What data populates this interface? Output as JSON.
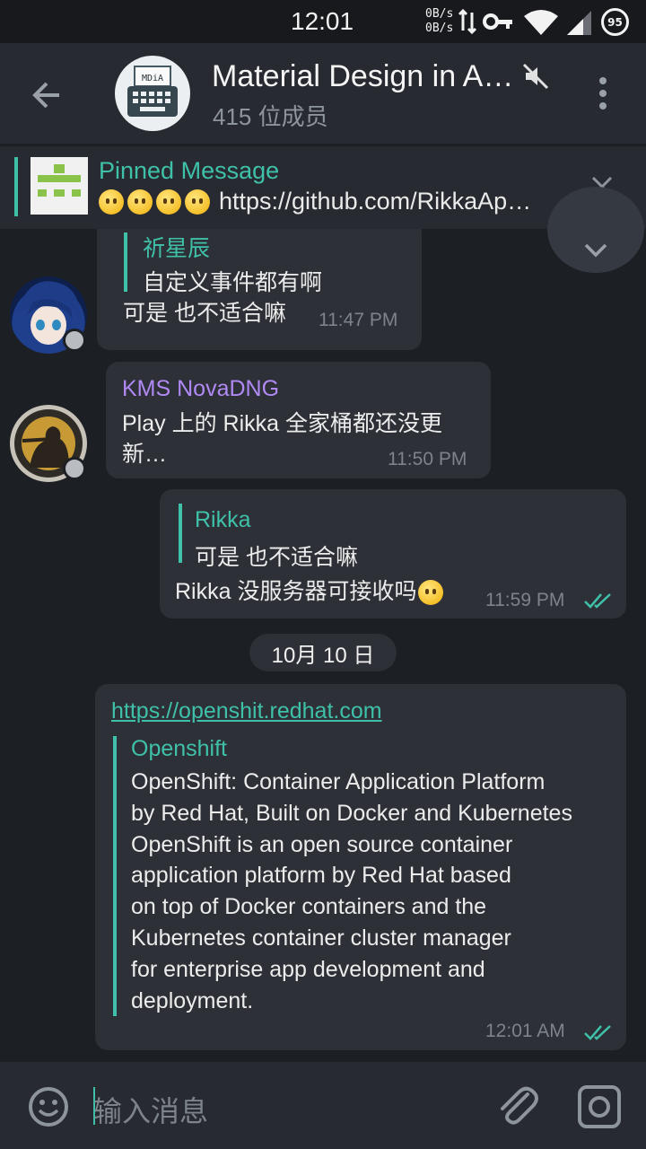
{
  "status_bar": {
    "time": "12:01",
    "net_up": "0B/s",
    "net_down": "0B/s",
    "battery": "95"
  },
  "toolbar": {
    "title": "Material Design in A…",
    "subtitle": "415 位成员",
    "avatar_label": "MDiA"
  },
  "pinned": {
    "title": "Pinned Message",
    "text": "https://github.com/RikkaAp…"
  },
  "messages": [
    {
      "reply_name": "祈星辰",
      "reply_text": "自定义事件都有啊",
      "body": "可是 也不适合嘛",
      "time": "11:47 PM"
    },
    {
      "sender": "KMS NovaDNG",
      "body_line1": "Play 上的 Rikka 全家桶都还没更",
      "body_line2": "新…",
      "time": "11:50 PM"
    },
    {
      "reply_name": "Rikka",
      "reply_text": "可是 也不适合嘛",
      "body": "Rikka 没服务器可接收吗",
      "time": "11:59 PM"
    },
    {
      "link": "https://openshit.redhat.com",
      "preview_site": "Openshift",
      "preview_lines": [
        "OpenShift: Container Application Platform",
        "by Red Hat, Built on Docker and Kubernetes",
        "OpenShift is an open source container",
        "application platform by Red Hat based",
        "on top of Docker containers and the",
        "Kubernetes container cluster manager",
        "for enterprise app development and",
        "deployment."
      ],
      "time": "12:01 AM"
    }
  ],
  "date_chip": "10月 10 日",
  "input": {
    "placeholder": "输入消息"
  },
  "colors": {
    "accent": "#3fc1a9",
    "sender_purple": "#b189f5",
    "background": "#1c1f24",
    "bubble": "#2d3036"
  }
}
